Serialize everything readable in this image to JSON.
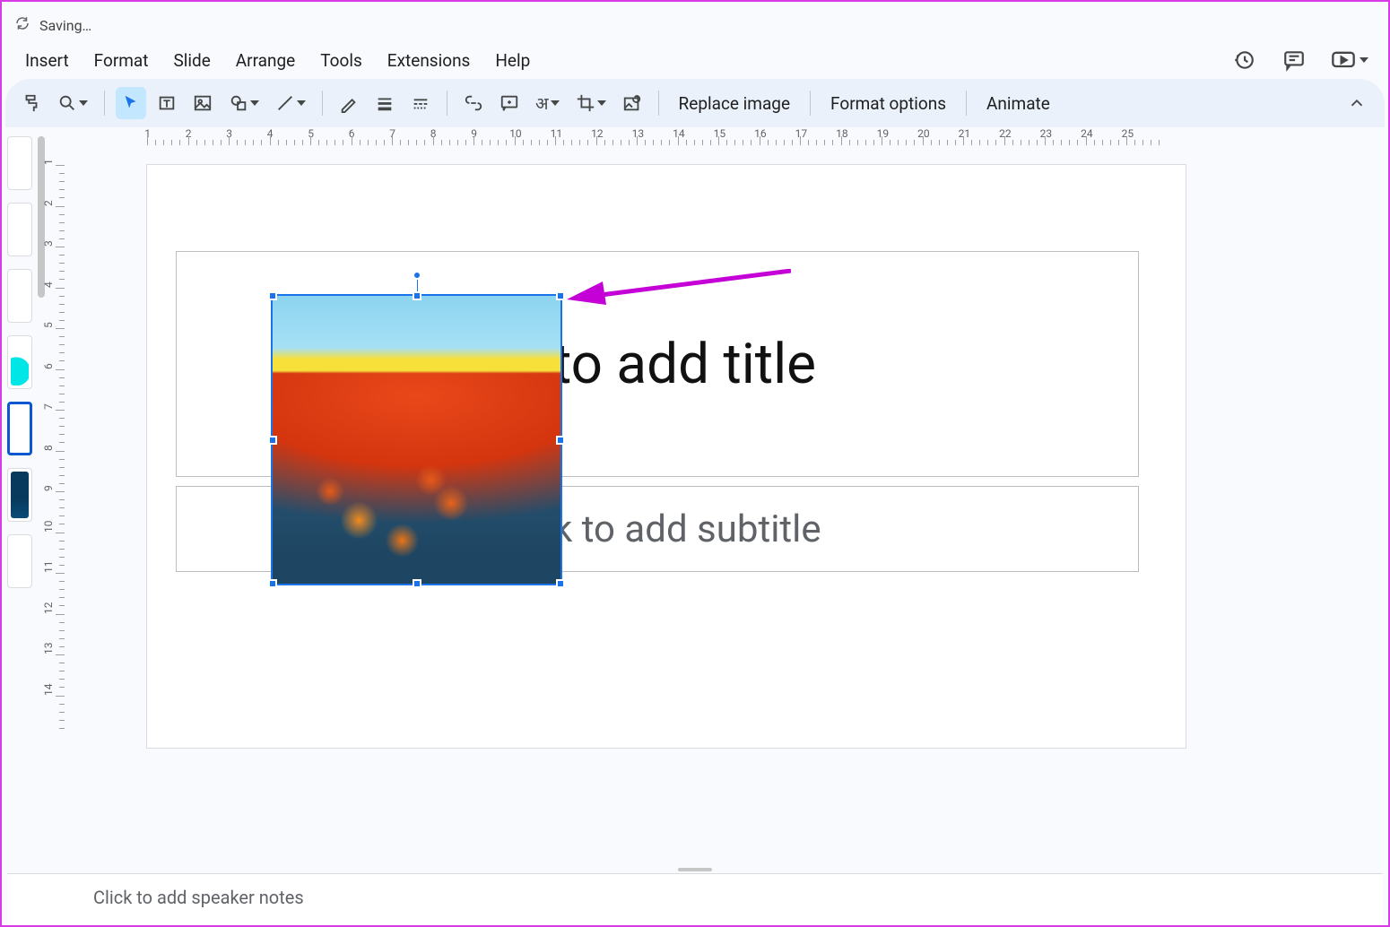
{
  "titlebar": {
    "status": "Saving…"
  },
  "menu": {
    "items": [
      "Insert",
      "Format",
      "Slide",
      "Arrange",
      "Tools",
      "Extensions",
      "Help"
    ]
  },
  "toolbar": {
    "replace_image": "Replace image",
    "format_options": "Format options",
    "animate": "Animate"
  },
  "ruler": {
    "h_labels": [
      "1",
      "2",
      "3",
      "4",
      "5",
      "6",
      "7",
      "8",
      "9",
      "10",
      "11",
      "12",
      "13",
      "14",
      "15",
      "16",
      "17",
      "18",
      "19",
      "20",
      "21",
      "22",
      "23",
      "24",
      "25"
    ],
    "v_labels": [
      "1",
      "2",
      "3",
      "4",
      "5",
      "6",
      "7",
      "8",
      "9",
      "10",
      "11",
      "12",
      "13",
      "14"
    ]
  },
  "slide": {
    "title_placeholder": " to add title",
    "subtitle_placeholder": "k to add subtitle"
  },
  "notes": {
    "placeholder": "Click to add speaker notes"
  }
}
